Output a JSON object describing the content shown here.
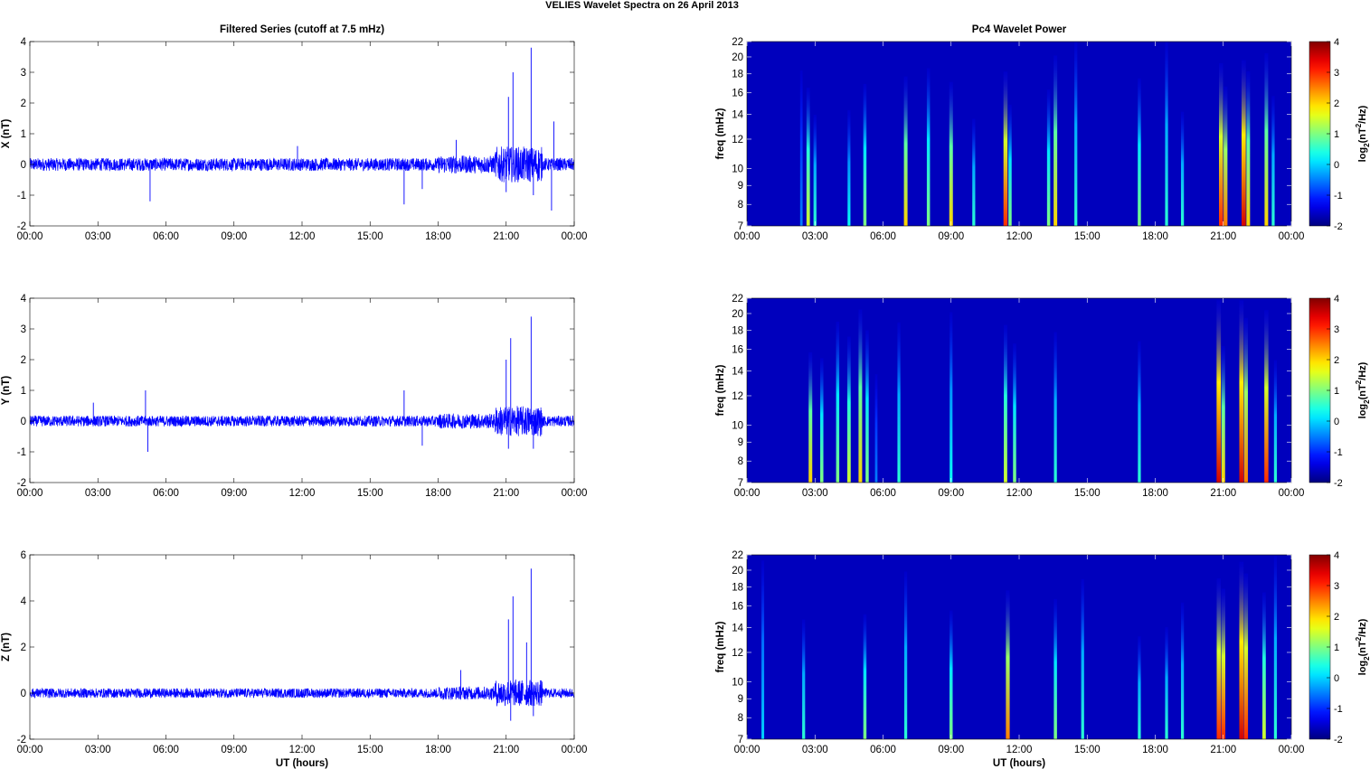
{
  "title": "VELIES Wavelet Spectra on 26 April    2013",
  "chart_data": [
    {
      "type": "line",
      "title": "Filtered Series (cutoff at 7.5 mHz)",
      "ylabel": "X (nT)",
      "xlabel": "",
      "xlim": [
        0,
        24
      ],
      "ylim": [
        -2,
        4
      ],
      "xticks": [
        "00:00",
        "03:00",
        "06:00",
        "09:00",
        "12:00",
        "15:00",
        "18:00",
        "21:00",
        "00:00"
      ],
      "yticks": [
        -2,
        -1,
        0,
        1,
        2,
        3,
        4
      ],
      "noise_amplitude": 0.13,
      "spikes": [
        [
          5.3,
          -1.2
        ],
        [
          11.8,
          0.6
        ],
        [
          16.5,
          -1.3
        ],
        [
          17.3,
          -0.8
        ],
        [
          18.8,
          0.8
        ],
        [
          21.0,
          -0.9
        ],
        [
          21.1,
          2.2
        ],
        [
          21.3,
          3.0
        ],
        [
          22.1,
          3.8
        ],
        [
          22.2,
          -1.0
        ],
        [
          23.0,
          -1.5
        ],
        [
          23.1,
          1.4
        ]
      ],
      "color": "#0000ff"
    },
    {
      "type": "line",
      "title": "",
      "ylabel": "Y (nT)",
      "xlabel": "",
      "xlim": [
        0,
        24
      ],
      "ylim": [
        -2,
        4
      ],
      "xticks": [
        "00:00",
        "03:00",
        "06:00",
        "09:00",
        "12:00",
        "15:00",
        "18:00",
        "21:00",
        "00:00"
      ],
      "yticks": [
        -2,
        -1,
        0,
        1,
        2,
        3,
        4
      ],
      "noise_amplitude": 0.11,
      "spikes": [
        [
          2.8,
          0.6
        ],
        [
          5.1,
          1.0
        ],
        [
          5.2,
          -1.0
        ],
        [
          16.5,
          1.0
        ],
        [
          17.3,
          -0.8
        ],
        [
          21.0,
          2.0
        ],
        [
          21.1,
          -0.9
        ],
        [
          21.2,
          2.7
        ],
        [
          22.1,
          3.4
        ],
        [
          22.2,
          -0.9
        ]
      ],
      "color": "#0000ff"
    },
    {
      "type": "line",
      "title": "",
      "ylabel": "Z (nT)",
      "xlabel": "UT (hours)",
      "xlim": [
        0,
        24
      ],
      "ylim": [
        -2,
        6
      ],
      "xticks": [
        "00:00",
        "03:00",
        "06:00",
        "09:00",
        "12:00",
        "15:00",
        "18:00",
        "21:00",
        "00:00"
      ],
      "yticks": [
        -2,
        0,
        2,
        4,
        6
      ],
      "noise_amplitude": 0.13,
      "spikes": [
        [
          19.0,
          1.0
        ],
        [
          21.1,
          3.2
        ],
        [
          21.2,
          -1.2
        ],
        [
          21.3,
          4.2
        ],
        [
          21.9,
          2.2
        ],
        [
          22.1,
          5.4
        ],
        [
          22.2,
          -1.0
        ]
      ],
      "color": "#0000ff"
    },
    {
      "type": "heatmap",
      "title": "Pc4 Wavelet Power",
      "ylabel": "freq (mHz)",
      "xlabel": "",
      "xlim": [
        0,
        24
      ],
      "ylim": [
        7,
        22
      ],
      "yscale": "log",
      "xticks": [
        "00:00",
        "03:00",
        "06:00",
        "09:00",
        "12:00",
        "15:00",
        "18:00",
        "21:00",
        "00:00"
      ],
      "yticks": [
        7,
        8,
        9,
        10,
        12,
        14,
        16,
        18,
        20,
        22
      ],
      "colorbar": {
        "label": "log2(nT2/Hz)",
        "range": [
          -2,
          4
        ],
        "ticks": [
          -2,
          -1,
          0,
          1,
          2,
          3,
          4
        ]
      },
      "bursts": [
        [
          2.4,
          -0.5
        ],
        [
          2.7,
          1.5
        ],
        [
          3.0,
          0.5
        ],
        [
          4.5,
          0.3
        ],
        [
          5.2,
          1
        ],
        [
          7.0,
          2
        ],
        [
          8.0,
          1
        ],
        [
          9.0,
          2
        ],
        [
          10.0,
          0.5
        ],
        [
          11.4,
          3
        ],
        [
          11.6,
          1
        ],
        [
          13.3,
          1
        ],
        [
          13.6,
          2
        ],
        [
          14.5,
          0.5
        ],
        [
          17.3,
          1
        ],
        [
          18.5,
          0.5
        ],
        [
          19.2,
          0.5
        ],
        [
          20.9,
          3
        ],
        [
          21.1,
          2.5
        ],
        [
          21.9,
          3.5
        ],
        [
          22.1,
          2
        ],
        [
          22.9,
          2
        ],
        [
          23.2,
          0.5
        ]
      ]
    },
    {
      "type": "heatmap",
      "title": "",
      "ylabel": "freq (mHz)",
      "xlabel": "",
      "xlim": [
        0,
        24
      ],
      "ylim": [
        7,
        22
      ],
      "yscale": "log",
      "xticks": [
        "00:00",
        "03:00",
        "06:00",
        "09:00",
        "12:00",
        "15:00",
        "18:00",
        "21:00",
        "00:00"
      ],
      "yticks": [
        7,
        8,
        9,
        10,
        12,
        14,
        16,
        18,
        20,
        22
      ],
      "colorbar": {
        "label": "log2(nT2/Hz)",
        "range": [
          -2,
          4
        ],
        "ticks": [
          -2,
          -1,
          0,
          1,
          2,
          3,
          4
        ]
      },
      "bursts": [
        [
          2.8,
          2
        ],
        [
          3.3,
          1
        ],
        [
          4.0,
          1
        ],
        [
          4.5,
          1.5
        ],
        [
          5.0,
          2
        ],
        [
          5.3,
          1
        ],
        [
          5.7,
          -0.5
        ],
        [
          6.7,
          0.5
        ],
        [
          9.0,
          0.3
        ],
        [
          11.4,
          1.5
        ],
        [
          11.8,
          1
        ],
        [
          13.6,
          0.5
        ],
        [
          17.3,
          0.5
        ],
        [
          20.8,
          3.5
        ],
        [
          21.0,
          2
        ],
        [
          21.8,
          3.5
        ],
        [
          22.0,
          2.5
        ],
        [
          22.9,
          3
        ],
        [
          23.3,
          0.5
        ]
      ]
    },
    {
      "type": "heatmap",
      "title": "",
      "ylabel": "freq (mHz)",
      "xlabel": "UT (hours)",
      "xlim": [
        0,
        24
      ],
      "ylim": [
        7,
        22
      ],
      "yscale": "log",
      "xticks": [
        "00:00",
        "03:00",
        "06:00",
        "09:00",
        "12:00",
        "15:00",
        "18:00",
        "21:00",
        "00:00"
      ],
      "yticks": [
        7,
        8,
        9,
        10,
        12,
        14,
        16,
        18,
        20,
        22
      ],
      "colorbar": {
        "label": "log2(nT2/Hz)",
        "range": [
          -2,
          4
        ],
        "ticks": [
          -2,
          -1,
          0,
          1,
          2,
          3,
          4
        ]
      },
      "bursts": [
        [
          0.7,
          0
        ],
        [
          2.5,
          0.5
        ],
        [
          5.2,
          1
        ],
        [
          7.0,
          0.5
        ],
        [
          9.0,
          1
        ],
        [
          11.5,
          2.5
        ],
        [
          13.6,
          1
        ],
        [
          14.8,
          0.5
        ],
        [
          17.3,
          0.5
        ],
        [
          18.5,
          0.5
        ],
        [
          19.2,
          0.5
        ],
        [
          20.8,
          3
        ],
        [
          21.0,
          3
        ],
        [
          21.8,
          3.5
        ],
        [
          22.0,
          3
        ],
        [
          22.8,
          1.5
        ],
        [
          23.3,
          0.5
        ]
      ]
    }
  ]
}
